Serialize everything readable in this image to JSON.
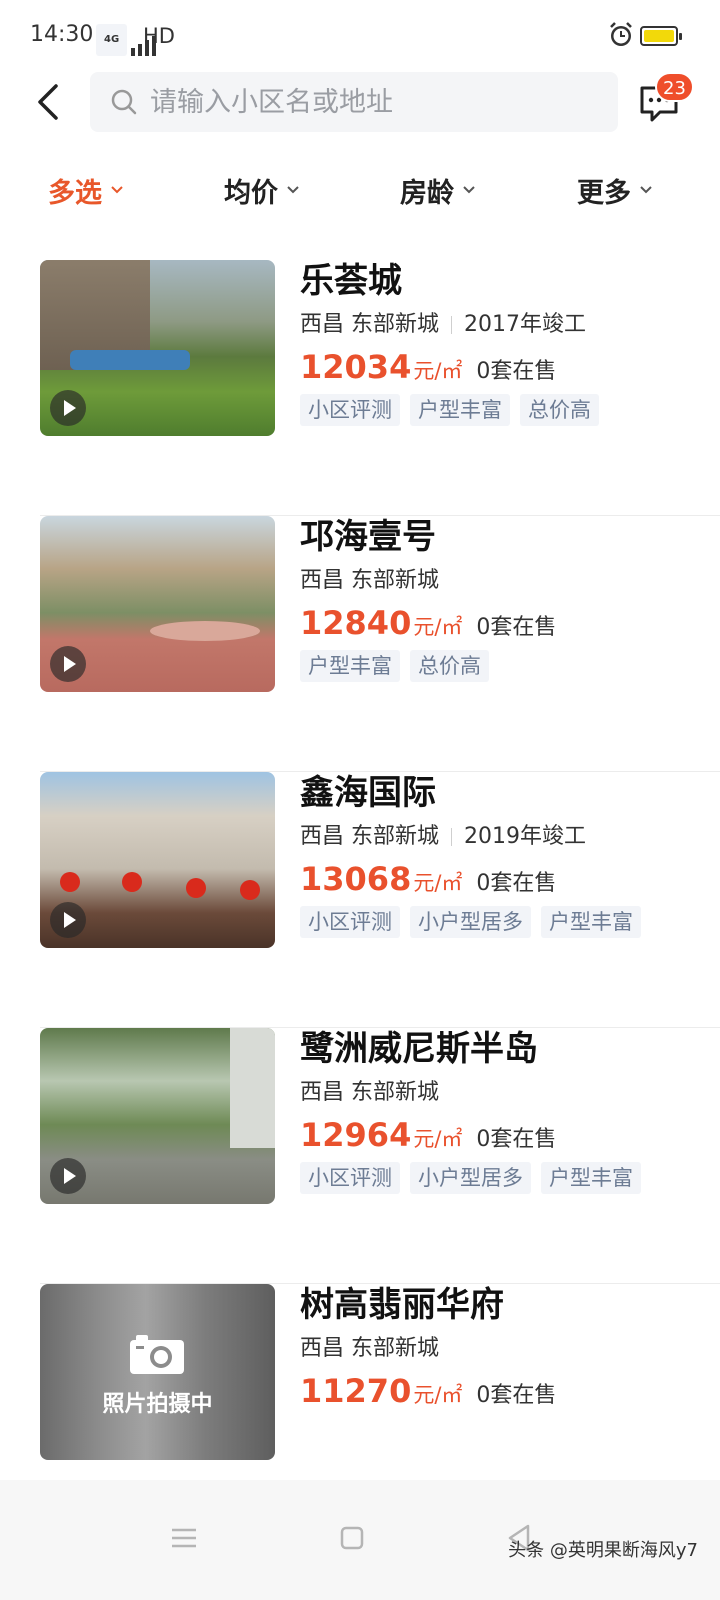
{
  "status_bar": {
    "time": "14:30",
    "network": "4G",
    "hd": "HD",
    "battery_color": "#f2d90a"
  },
  "header": {
    "search_placeholder": "请输入小区名或地址",
    "message_badge": "23"
  },
  "filters": [
    {
      "label": "多选",
      "active": true
    },
    {
      "label": "均价",
      "active": false
    },
    {
      "label": "房龄",
      "active": false
    },
    {
      "label": "更多",
      "active": false
    }
  ],
  "colors": {
    "accent": "#e9512d",
    "tag_bg": "#f2f4f8",
    "tag_text": "#6d7c94"
  },
  "listings": [
    {
      "name": "乐荟城",
      "location": "西昌 东部新城",
      "completed": "2017年竣工",
      "price": "12034",
      "unit": "元/㎡",
      "on_sale": "0套在售",
      "tags": [
        "小区评测",
        "户型丰富",
        "总价高"
      ],
      "has_video": true
    },
    {
      "name": "邛海壹号",
      "location": "西昌 东部新城",
      "completed": "",
      "price": "12840",
      "unit": "元/㎡",
      "on_sale": "0套在售",
      "tags": [
        "户型丰富",
        "总价高"
      ],
      "has_video": true
    },
    {
      "name": "鑫海国际",
      "location": "西昌 东部新城",
      "completed": "2019年竣工",
      "price": "13068",
      "unit": "元/㎡",
      "on_sale": "0套在售",
      "tags": [
        "小区评测",
        "小户型居多",
        "户型丰富"
      ],
      "has_video": true
    },
    {
      "name": "鹭洲威尼斯半岛",
      "location": "西昌 东部新城",
      "completed": "",
      "price": "12964",
      "unit": "元/㎡",
      "on_sale": "0套在售",
      "tags": [
        "小区评测",
        "小户型居多",
        "户型丰富"
      ],
      "has_video": true
    },
    {
      "name": "树高翡丽华府",
      "location": "西昌 东部新城",
      "completed": "",
      "price": "11270",
      "unit": "元/㎡",
      "on_sale": "0套在售",
      "tags": [],
      "has_video": false,
      "placeholder_text": "照片拍摄中"
    }
  ],
  "watermark": "头条 @英明果断海风y7"
}
